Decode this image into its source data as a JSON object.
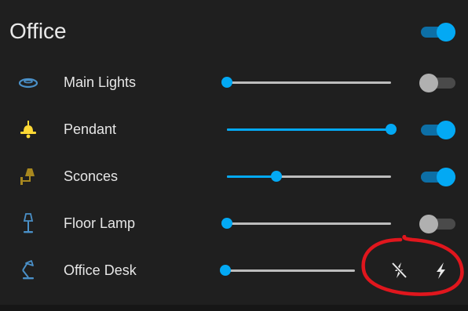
{
  "card": {
    "title": "Office",
    "master_toggle": "on"
  },
  "rows": [
    {
      "label": "Main Lights",
      "icon": "ceiling-light-icon",
      "icon_color": "#4a90c8",
      "brightness": 0,
      "toggle": "off"
    },
    {
      "label": "Pendant",
      "icon": "pendant-light-icon",
      "icon_color": "#fdd835",
      "brightness": 1.0,
      "toggle": "on"
    },
    {
      "label": "Sconces",
      "icon": "wall-sconce-icon",
      "icon_color": "#a8881f",
      "brightness": 0.3,
      "toggle": "on"
    },
    {
      "label": "Floor Lamp",
      "icon": "floor-lamp-icon",
      "icon_color": "#4a90c8",
      "brightness": 0,
      "toggle": "off"
    },
    {
      "label": "Office Desk",
      "icon": "desk-lamp-icon",
      "icon_color": "#4a90c8",
      "brightness": 0,
      "buttons": [
        "flash-off-icon",
        "flash-icon"
      ]
    }
  ],
  "colors": {
    "accent": "#03a9f4",
    "background": "#1f1f1f",
    "annotation": "#e0161d"
  }
}
